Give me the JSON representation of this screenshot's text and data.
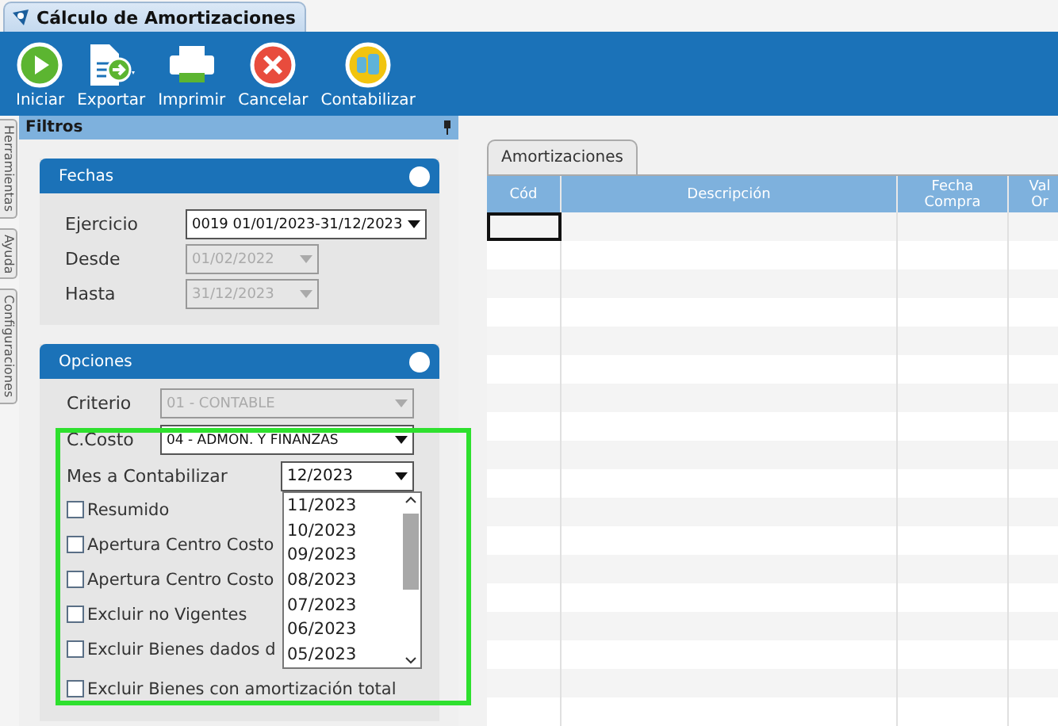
{
  "window": {
    "title": "Cálculo de Amortizaciones"
  },
  "toolbar": [
    {
      "kind": "start",
      "label": "Iniciar"
    },
    {
      "kind": "export",
      "label": "Exportar"
    },
    {
      "kind": "print",
      "label": "Imprimir"
    },
    {
      "kind": "cancel",
      "label": "Cancelar"
    },
    {
      "kind": "post",
      "label": "Contabilizar"
    }
  ],
  "side_tabs": [
    "Herramientas",
    "Ayuda",
    "Configuraciones"
  ],
  "filters": {
    "title": "Filtros",
    "fechas": {
      "title": "Fechas",
      "fields": [
        {
          "label": "Ejercicio",
          "value": "0019 01/01/2023-31/12/2023",
          "disabled": false,
          "wide": true
        },
        {
          "label": "Desde",
          "value": "01/02/2022",
          "disabled": true,
          "wide": false
        },
        {
          "label": "Hasta",
          "value": "31/12/2023",
          "disabled": true,
          "wide": false
        }
      ]
    },
    "opciones": {
      "title": "Opciones",
      "criterio": {
        "label": "Criterio",
        "value": "01 - CONTABLE",
        "disabled": true
      },
      "costo": {
        "label": "C.Costo",
        "value": "04 - ADMON. Y FINANZAS",
        "disabled": false
      },
      "mes": {
        "label": "Mes a Contabilizar",
        "value": "12/2023",
        "expanded": true,
        "options": [
          "11/2023",
          "10/2023",
          "09/2023",
          "08/2023",
          "07/2023",
          "06/2023",
          "05/2023"
        ]
      },
      "checks": [
        {
          "label": "Resumido",
          "checked": false
        },
        {
          "label": "Apertura Centro Costo",
          "checked": false
        },
        {
          "label": "Apertura Centro Costo",
          "checked": false
        },
        {
          "label": "Excluir no Vigentes",
          "checked": false
        },
        {
          "label": "Excluir Bienes dados d",
          "checked": false
        },
        {
          "label": "Excluir Bienes con amortización total",
          "checked": false
        }
      ]
    }
  },
  "results": {
    "tab": "Amortizaciones",
    "columns": [
      "Cód",
      "Descripción",
      "Fecha\nCompra",
      "Val\nOr"
    ],
    "rows": [
      {
        "focused": true
      },
      {
        "focused": false
      },
      {
        "focused": false
      },
      {
        "focused": false
      },
      {
        "focused": false
      },
      {
        "focused": false
      },
      {
        "focused": false
      },
      {
        "focused": false
      },
      {
        "focused": false
      },
      {
        "focused": false
      },
      {
        "focused": false
      },
      {
        "focused": false
      },
      {
        "focused": false
      },
      {
        "focused": false
      },
      {
        "focused": false
      },
      {
        "focused": false
      },
      {
        "focused": false
      },
      {
        "focused": false
      }
    ]
  }
}
